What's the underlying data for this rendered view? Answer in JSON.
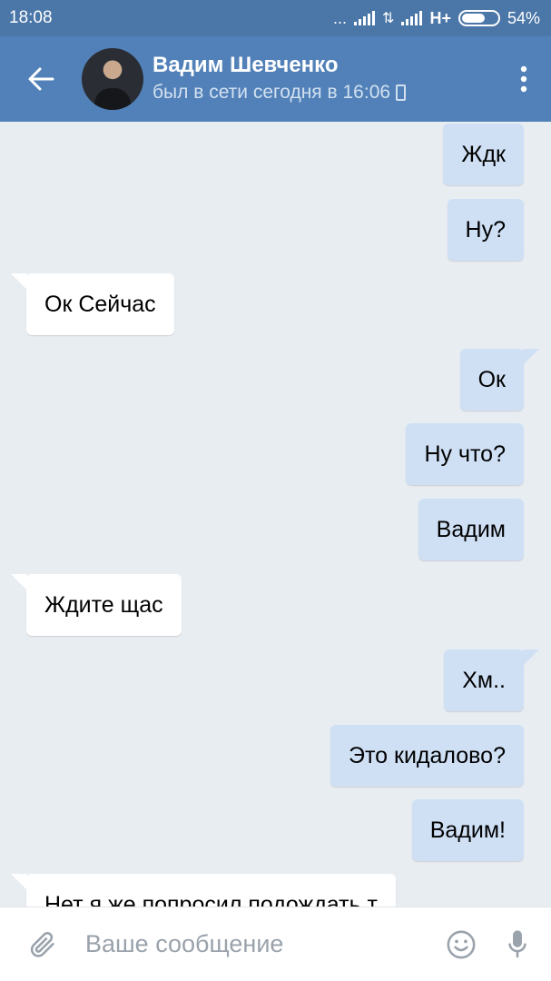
{
  "status_bar": {
    "time": "18:08",
    "dots": "...",
    "network": "H+",
    "battery": "54%"
  },
  "header": {
    "name": "Вадим Шевченко",
    "status": "был в сети сегодня в 16:06"
  },
  "messages": [
    {
      "text": "Ждк",
      "dir": "out"
    },
    {
      "text": "Ну?",
      "dir": "out"
    },
    {
      "text": "Ок Сейчас",
      "dir": "in"
    },
    {
      "text": "Ок",
      "dir": "out"
    },
    {
      "text": "Ну что?",
      "dir": "out"
    },
    {
      "text": "Вадим",
      "dir": "out"
    },
    {
      "text": "Ждите щас",
      "dir": "in"
    },
    {
      "text": "Хм..",
      "dir": "out"
    },
    {
      "text": "Это кидалово?",
      "dir": "out"
    },
    {
      "text": "Вадим!",
      "dir": "out"
    },
    {
      "text": "Нет я же попросил подождать т",
      "dir": "in"
    }
  ],
  "composer": {
    "placeholder": "Ваше сообщение"
  },
  "colors": {
    "accent": "#5181b8",
    "outgoing_bubble": "#cfe0f5",
    "incoming_bubble": "#ffffff",
    "chat_background": "#e8edf2"
  }
}
